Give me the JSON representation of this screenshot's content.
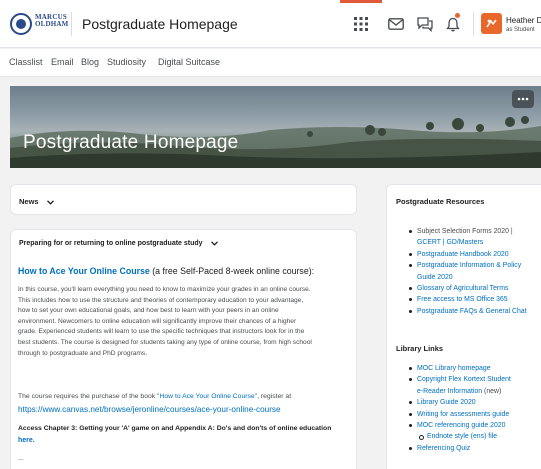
{
  "header": {
    "logo_text_1": "MARCUS",
    "logo_text_2": "OLDHAM",
    "title": "Postgraduate Homepage",
    "user_name": "Heather Davi",
    "user_role": "as Student"
  },
  "nav": {
    "items": [
      "Classlist",
      "Email",
      "Blog",
      "Studiosity",
      "Digital Suitcase"
    ]
  },
  "banner": {
    "title": "Postgraduate Homepage"
  },
  "news": {
    "label": "News"
  },
  "course_widget": {
    "heading": "Preparing for or returning to online postgraduate study",
    "link_title": "How to Ace Your Online Course",
    "link_suffix": " (a free Self-Paced 8-week online course):",
    "para1_lines": [
      "In this course, you'll learn everything you need to know to maximize your grades in an online course.",
      "This includes how to use the structure and theories of contemporary education to your advantage,",
      "how to set your own educational goals, and how best to learn with your peers in an online",
      "environment. Newcomers to online education will significantly improve their chances of a higher",
      "grade. Experienced students will learn to use the specific techniques that instructors look for in the",
      "best students. The course is designed for students taking any type of online course, from high school",
      "through to postgraduate and PhD programs."
    ],
    "purchase_prefix": "The course requires the purchase of the book ",
    "purchase_link": "\"How to Ace Your Online Course\"",
    "purchase_suffix": ", register at",
    "canvas_url": "https://www.canvas.net/browse/jeronline/courses/ace-your-online-course",
    "access_text": "Access Chapter 3: Getting your 'A' game on and Appendix A: Do's and don'ts of online education",
    "here_link": "here.",
    "ellipsis": "..."
  },
  "resources": {
    "heading": "Postgraduate Resources",
    "items": [
      {
        "text": "Subject Selection Forms 2020 |",
        "link": false
      },
      {
        "text": "GCERT | GD/Masters",
        "link": true,
        "cont": true
      },
      {
        "text": "Postgraduate Handbook 2020",
        "link": true
      },
      {
        "text": "Postgraduate Information & Policy",
        "link": true
      },
      {
        "text": "Guide 2020",
        "link": true,
        "cont": true
      },
      {
        "text": "Glossary of Agricultural Terms",
        "link": true
      },
      {
        "text": "Free access to MS Office 365",
        "link": true
      },
      {
        "text": "Postgraduate FAQs & General Chat",
        "link": true
      }
    ]
  },
  "library": {
    "heading": "Library Links",
    "items": [
      {
        "text": "MOC Library homepage",
        "link": true
      },
      {
        "text": "Copyright Flex Kortext Student",
        "link": true
      },
      {
        "text": "e-Reader Information",
        "link": true,
        "cont": true,
        "suffix": " (new)"
      },
      {
        "text": "Library Guide 2020",
        "link": true
      },
      {
        "text": "Writing for assessments guide",
        "link": true
      },
      {
        "text": "MOC referencing guide 2020",
        "link": true
      },
      {
        "text": "Endnote style (ens) file",
        "link": true,
        "sub": true
      },
      {
        "text": "Referencing Quiz",
        "link": true
      }
    ]
  },
  "colors": {
    "accent": "#e8682b",
    "link": "#006fbf",
    "brand": "#2a4a8a"
  },
  "icons": [
    "grid-icon",
    "mail-icon",
    "chat-icon",
    "bell-icon",
    "user-avatar-icon",
    "more-icon",
    "chevron-down-icon"
  ]
}
